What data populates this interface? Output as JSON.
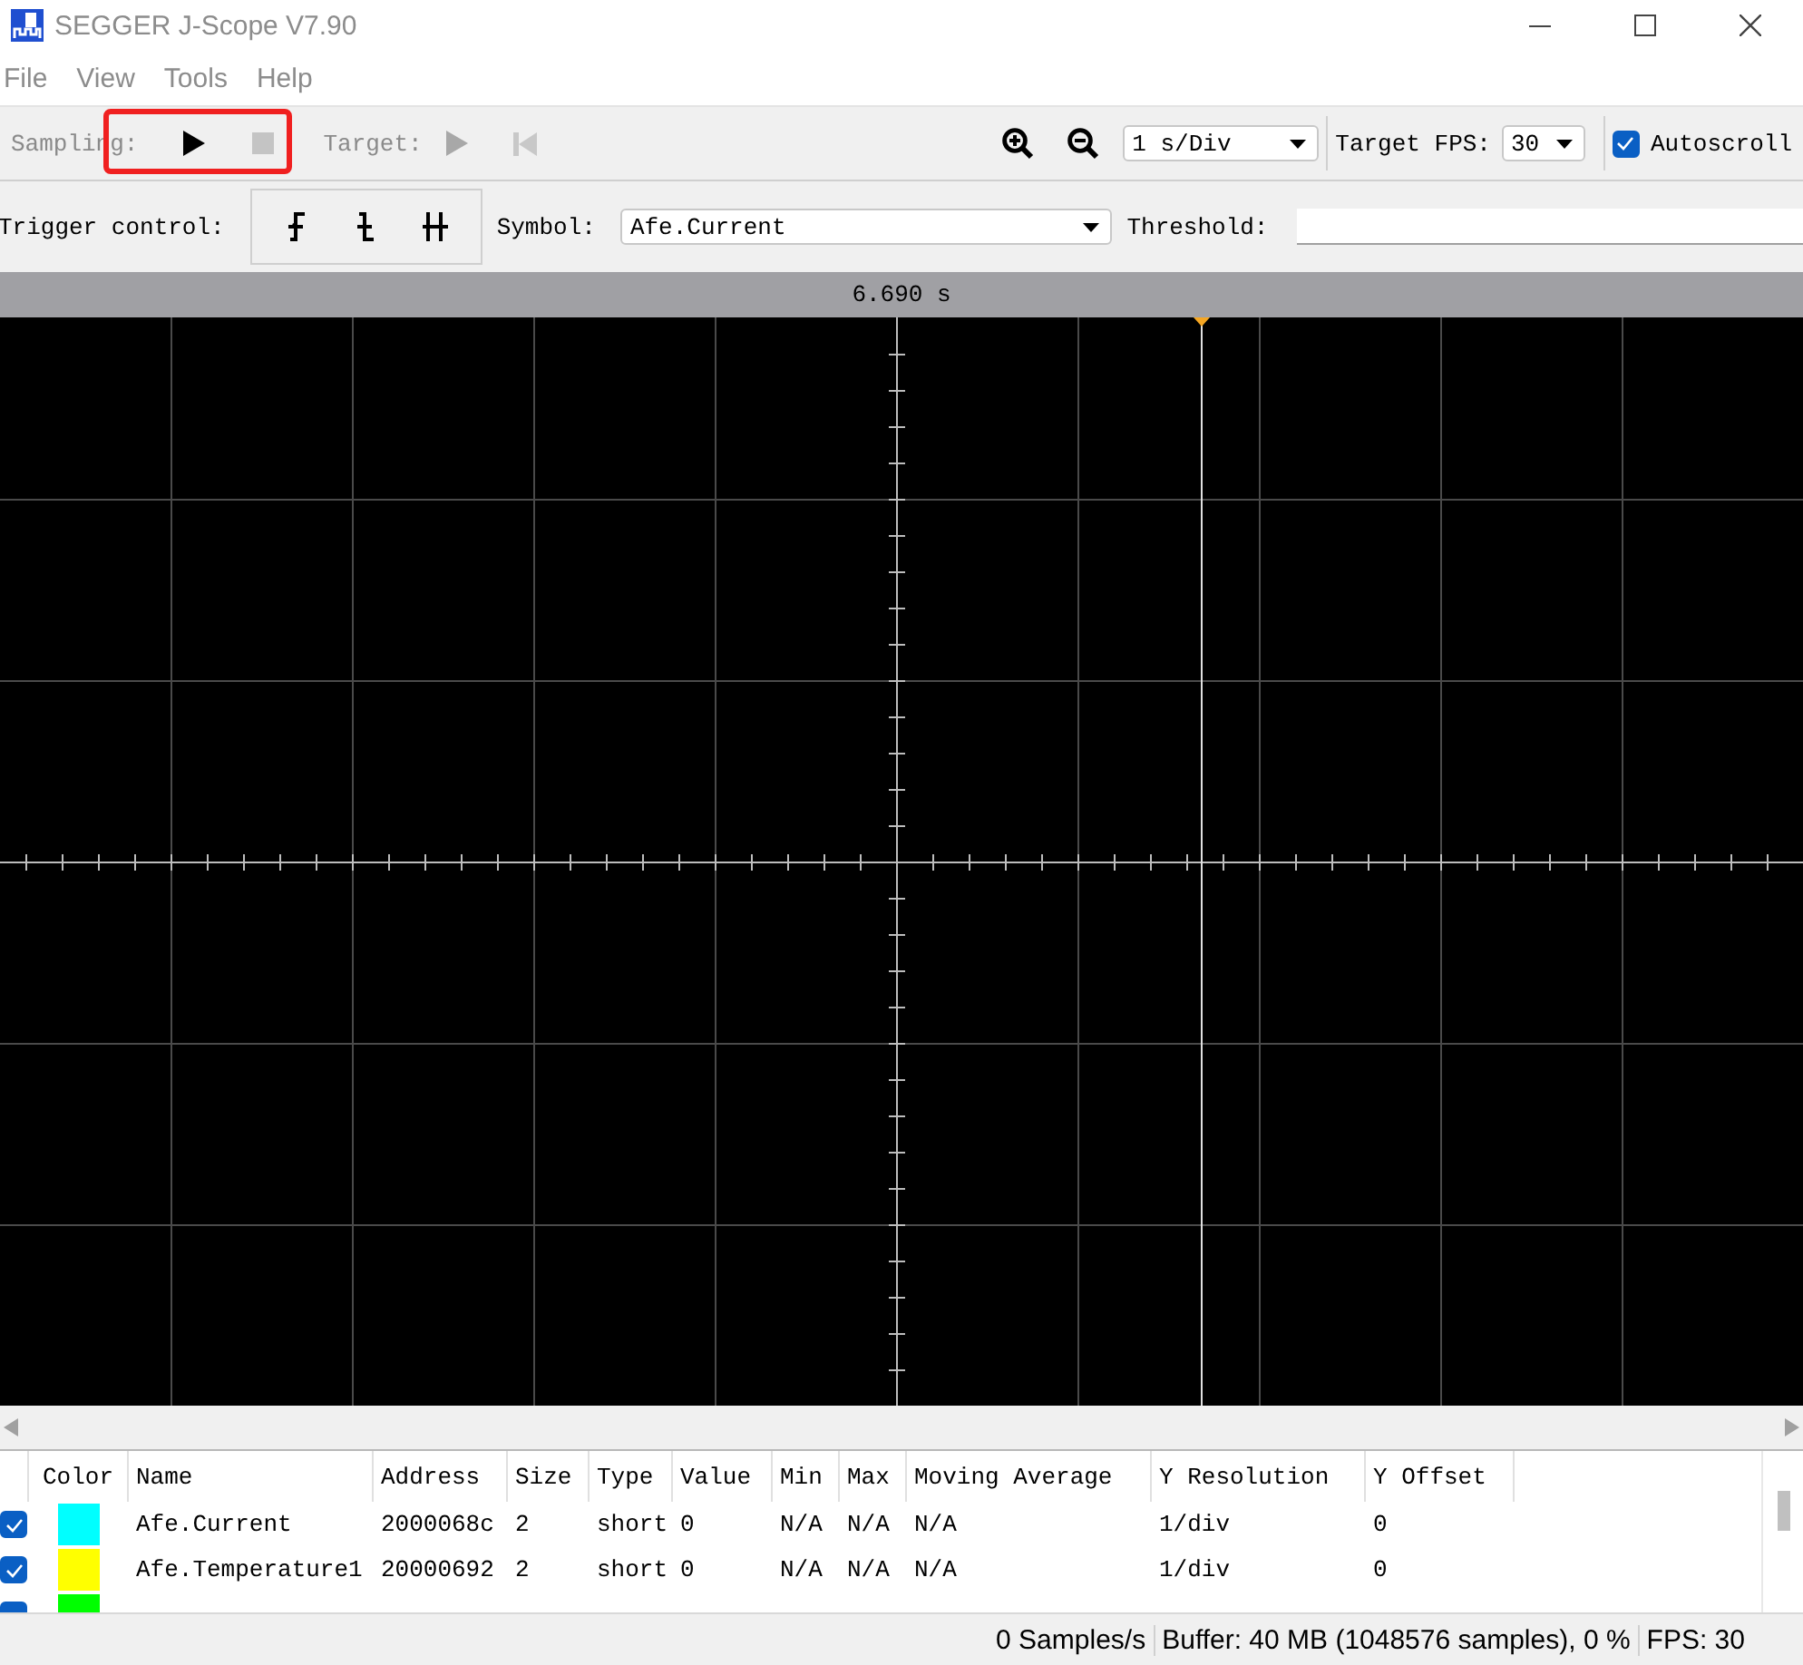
{
  "window": {
    "title": "SEGGER J-Scope V7.90"
  },
  "menu": [
    "File",
    "View",
    "Tools",
    "Help"
  ],
  "toolbar": {
    "sampling_label": "Sampling:",
    "sampling_highlighted": true,
    "sampling_buttons": [
      {
        "kind": "play",
        "disabled": false
      },
      {
        "kind": "stop",
        "disabled": true
      }
    ],
    "target_label": "Target:",
    "target_buttons": [
      {
        "kind": "play",
        "disabled": true
      },
      {
        "kind": "skip-start",
        "disabled": true
      }
    ],
    "zoom_buttons": [
      {
        "kind": "zoom-in"
      },
      {
        "kind": "zoom-out"
      }
    ],
    "time_div": "1 s/Div",
    "fps_label": "Target FPS:",
    "fps": "30",
    "autoscroll": {
      "label": "Autoscroll",
      "checked": true
    }
  },
  "trigger": {
    "label": "Trigger control:",
    "edges": [
      {
        "kind": "rising"
      },
      {
        "kind": "falling"
      },
      {
        "kind": "both"
      }
    ],
    "symbol_label": "Symbol:",
    "symbol": "Afe.Current",
    "threshold_label": "Threshold:"
  },
  "plot": {
    "time": "6.690 s"
  },
  "table": {
    "columns": [
      "Color",
      "Name",
      "Address",
      "Size",
      "Type",
      "Value",
      "Min",
      "Max",
      "Moving Average",
      "Y Resolution",
      "Y Offset"
    ],
    "rows": [
      {
        "checked": true,
        "color": "#00ffff",
        "cells": [
          "",
          "Afe.Current",
          "2000068c",
          "2",
          "short",
          "0",
          "N/A",
          "N/A",
          "N/A",
          "1/div",
          "0"
        ]
      },
      {
        "checked": true,
        "color": "#ffff00",
        "cells": [
          "",
          "Afe.Temperature1",
          "20000692",
          "2",
          "short",
          "0",
          "N/A",
          "N/A",
          "N/A",
          "1/div",
          "0"
        ]
      },
      {
        "checked": true,
        "color": "#00ff00",
        "cells": []
      }
    ]
  },
  "status_bar": [
    "0 Samples/s",
    "Buffer: 40 MB (1048576 samples), 0 %",
    "FPS: 30"
  ]
}
